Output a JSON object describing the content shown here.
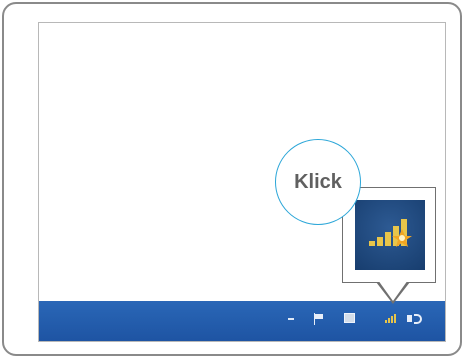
{
  "callout": {
    "label": "Klick"
  },
  "icons": [
    "show-hidden-icons-arrow",
    "action-center-flag-icon",
    "network-monitor-icon",
    "wifi-warning-icon",
    "volume-icon"
  ],
  "colors": {
    "taskbar": "#1e54a3",
    "callout_ring": "#2ba6d8",
    "label_text": "#606060",
    "signal_bar": "#e8c54a",
    "warning_star": "#f2a623"
  }
}
